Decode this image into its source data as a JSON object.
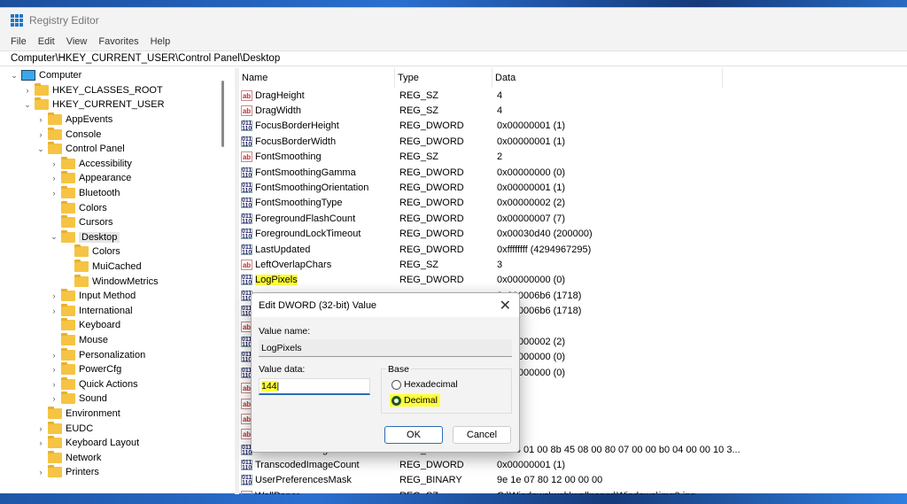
{
  "window": {
    "title": "Registry Editor"
  },
  "menu": [
    "File",
    "Edit",
    "View",
    "Favorites",
    "Help"
  ],
  "address": "Computer\\HKEY_CURRENT_USER\\Control Panel\\Desktop",
  "tree": [
    {
      "label": "Computer",
      "level": 0,
      "chev": "v",
      "icon": "monitor"
    },
    {
      "label": "HKEY_CLASSES_ROOT",
      "level": 1,
      "chev": ">"
    },
    {
      "label": "HKEY_CURRENT_USER",
      "level": 1,
      "chev": "v"
    },
    {
      "label": "AppEvents",
      "level": 2,
      "chev": ">"
    },
    {
      "label": "Console",
      "level": 2,
      "chev": ">"
    },
    {
      "label": "Control Panel",
      "level": 2,
      "chev": "v"
    },
    {
      "label": "Accessibility",
      "level": 3,
      "chev": ">"
    },
    {
      "label": "Appearance",
      "level": 3,
      "chev": ">"
    },
    {
      "label": "Bluetooth",
      "level": 3,
      "chev": ">"
    },
    {
      "label": "Colors",
      "level": 3,
      "chev": ""
    },
    {
      "label": "Cursors",
      "level": 3,
      "chev": ""
    },
    {
      "label": "Desktop",
      "level": 3,
      "chev": "v",
      "selected": true
    },
    {
      "label": "Colors",
      "level": 4,
      "chev": ""
    },
    {
      "label": "MuiCached",
      "level": 4,
      "chev": ""
    },
    {
      "label": "WindowMetrics",
      "level": 4,
      "chev": ""
    },
    {
      "label": "Input Method",
      "level": 3,
      "chev": ">"
    },
    {
      "label": "International",
      "level": 3,
      "chev": ">"
    },
    {
      "label": "Keyboard",
      "level": 3,
      "chev": ""
    },
    {
      "label": "Mouse",
      "level": 3,
      "chev": ""
    },
    {
      "label": "Personalization",
      "level": 3,
      "chev": ">"
    },
    {
      "label": "PowerCfg",
      "level": 3,
      "chev": ">"
    },
    {
      "label": "Quick Actions",
      "level": 3,
      "chev": ">"
    },
    {
      "label": "Sound",
      "level": 3,
      "chev": ">"
    },
    {
      "label": "Environment",
      "level": 2,
      "chev": ""
    },
    {
      "label": "EUDC",
      "level": 2,
      "chev": ">"
    },
    {
      "label": "Keyboard Layout",
      "level": 2,
      "chev": ">"
    },
    {
      "label": "Network",
      "level": 2,
      "chev": ""
    },
    {
      "label": "Printers",
      "level": 2,
      "chev": ">"
    }
  ],
  "columns": [
    "Name",
    "Type",
    "Data"
  ],
  "rows": [
    {
      "name": "DragHeight",
      "type": "REG_SZ",
      "data": "4"
    },
    {
      "name": "DragWidth",
      "type": "REG_SZ",
      "data": "4"
    },
    {
      "name": "FocusBorderHeight",
      "type": "REG_DWORD",
      "data": "0x00000001 (1)"
    },
    {
      "name": "FocusBorderWidth",
      "type": "REG_DWORD",
      "data": "0x00000001 (1)"
    },
    {
      "name": "FontSmoothing",
      "type": "REG_SZ",
      "data": "2"
    },
    {
      "name": "FontSmoothingGamma",
      "type": "REG_DWORD",
      "data": "0x00000000 (0)"
    },
    {
      "name": "FontSmoothingOrientation",
      "type": "REG_DWORD",
      "data": "0x00000001 (1)"
    },
    {
      "name": "FontSmoothingType",
      "type": "REG_DWORD",
      "data": "0x00000002 (2)"
    },
    {
      "name": "ForegroundFlashCount",
      "type": "REG_DWORD",
      "data": "0x00000007 (7)"
    },
    {
      "name": "ForegroundLockTimeout",
      "type": "REG_DWORD",
      "data": "0x00030d40 (200000)"
    },
    {
      "name": "LastUpdated",
      "type": "REG_DWORD",
      "data": "0xffffffff (4294967295)"
    },
    {
      "name": "LeftOverlapChars",
      "type": "REG_SZ",
      "data": "3"
    },
    {
      "name": "LogPixels",
      "type": "REG_DWORD",
      "data": "0x00000000 (0)",
      "highlight": true
    },
    {
      "name": "",
      "type": "",
      "data": "0x000006b6 (1718)",
      "kind": "dw"
    },
    {
      "name": "",
      "type": "",
      "data": "0x000006b6 (1718)",
      "kind": "dw"
    },
    {
      "name": "",
      "type": "",
      "data": "",
      "kind": "sz"
    },
    {
      "name": "",
      "type": "",
      "data": "0x00000002 (2)",
      "kind": "dw"
    },
    {
      "name": "",
      "type": "",
      "data": "0x00000000 (0)",
      "kind": "dw"
    },
    {
      "name": "",
      "type": "",
      "data": "0x00000000 (0)",
      "kind": "dw"
    },
    {
      "name": "",
      "type": "",
      "data": "",
      "kind": "sz"
    },
    {
      "name": "",
      "type": "",
      "data": "",
      "kind": "sz"
    },
    {
      "name": "",
      "type": "",
      "data": "",
      "kind": "sz"
    },
    {
      "name": "",
      "type": "",
      "data": "",
      "kind": "sz"
    },
    {
      "name": "TranscodedImageCache",
      "type": "REG_BINARY",
      "data": "7a c3 01 00 8b 45 08 00 80 07 00 00 b0 04 00 00 10 3..."
    },
    {
      "name": "TranscodedImageCount",
      "type": "REG_DWORD",
      "data": "0x00000001 (1)"
    },
    {
      "name": "UserPreferencesMask",
      "type": "REG_BINARY",
      "data": "9e 1e 07 80 12 00 00 00"
    },
    {
      "name": "WallPaper",
      "type": "REG_SZ",
      "data": "C:\\Windows\\web\\wallpaper\\Windows\\img0.jpg"
    }
  ],
  "dialog": {
    "title": "Edit DWORD (32-bit) Value",
    "value_name_label": "Value name:",
    "value_name": "LogPixels",
    "value_data_label": "Value data:",
    "value_data": "144",
    "base_label": "Base",
    "hex_label": "Hexadecimal",
    "dec_label": "Decimal",
    "selected_base": "Decimal",
    "ok": "OK",
    "cancel": "Cancel"
  },
  "colors": {
    "highlight": "#ffff3a",
    "accent": "#2a6db5"
  }
}
